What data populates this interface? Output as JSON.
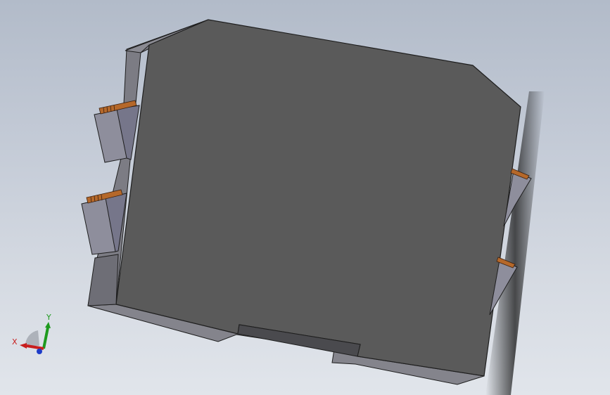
{
  "viewport": {
    "background_top": "#b2bbc9",
    "background_bottom": "#e1e5eb"
  },
  "model": {
    "name": "din-rail-module",
    "body_color": "#5a5a5a",
    "edge_color": "#1e1e1e",
    "side_color": "#7a7a82",
    "terminal_color": "#8e8e9c",
    "contact_color": "#b5682a"
  },
  "triad": {
    "x_label": "X",
    "y_label": "Y",
    "x_color": "#c81e1e",
    "y_color": "#1e9a1e",
    "z_color": "#1e3cc8"
  }
}
